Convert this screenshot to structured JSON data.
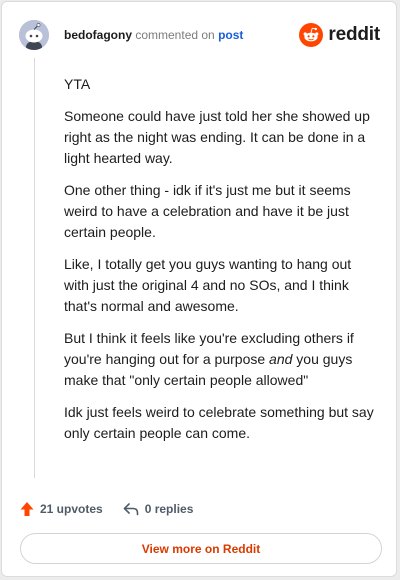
{
  "header": {
    "username": "bedofagony",
    "action_text": "commented on",
    "post_link": "post",
    "brand_name": "reddit"
  },
  "comment": {
    "paragraphs": [
      "YTA",
      "Someone could have just told her she showed up right as the night was ending. It can be done in a light hearted way.",
      "One other thing - idk if it's just me but it seems weird to have a celebration and have it be just certain people.",
      "Like, I totally get you guys wanting to hang out with just the original 4 and no SOs, and I think that's normal and awesome.",
      {
        "before": "But I think it feels like you're excluding others if you're hanging out for a purpose ",
        "emphasis": "and",
        "after": " you guys make that \"only certain people allowed\""
      },
      "Idk just feels weird to celebrate something but say only certain people can come."
    ]
  },
  "actions": {
    "upvotes": "21 upvotes",
    "replies": "0 replies"
  },
  "footer": {
    "view_more": "View more on Reddit"
  },
  "colors": {
    "brand_orange": "#ff4500",
    "upvote_icon": "#ff4500",
    "link_blue": "#1a5ed6",
    "view_more_text": "#d93a00"
  },
  "icons": {
    "avatar": "snoo-avatar-icon",
    "brand": "reddit-logo-icon",
    "upvote": "upvote-arrow-icon",
    "reply": "reply-arrow-icon"
  }
}
